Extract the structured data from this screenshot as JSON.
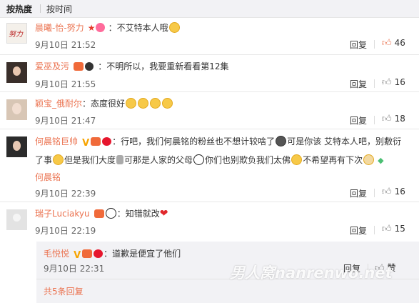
{
  "sort": {
    "hot": "按热度",
    "time": "按时间"
  },
  "comments": [
    {
      "name": "晨曦-怡-努力",
      "text": "：不艾特本人哦",
      "time": "9月10日 21:52",
      "reply": "回复",
      "likes": "46",
      "liked": true,
      "avatar_text": "努力"
    },
    {
      "name": "爱巫及污",
      "text": "：不明所以，我要重新看看第12集",
      "time": "9月10日 21:55",
      "reply": "回复",
      "likes": "16"
    },
    {
      "name": "颖宝_俄耐尔",
      "text": "：态度很好",
      "time": "9月10日 21:47",
      "reply": "回复",
      "likes": "18"
    },
    {
      "name": "何晨铭巨帅",
      "text1": "：行吧，我们何晨铭的粉丝也不想计较啥了",
      "text2": "可是你该 艾特本人吧，别敷衍",
      "text3": "了事",
      "text4": "但是我们大度",
      "text5": "可那是人家的父母",
      "text6": "你们也别欺负我们太佛",
      "text7": "不希望再有下次",
      "mention": "何晨铭",
      "time": "9月10日 22:39",
      "reply": "回复",
      "likes": "16"
    },
    {
      "name": "瑞子Luciakyu",
      "text": "：知错就改",
      "time": "9月10日 22:19",
      "reply": "回复",
      "likes": "15"
    }
  ],
  "subreply": {
    "name": "毛悦悦",
    "text": "：道歉是便宜了他们",
    "time": "9月10日 22:31",
    "reply": "回复",
    "like_label": "赞",
    "more": "共5条回复"
  },
  "watermark": "男人窝nanrenwo.net",
  "colors": {
    "name": "#eb7350",
    "like_active": "#eb7350",
    "link": "#eb7350"
  }
}
